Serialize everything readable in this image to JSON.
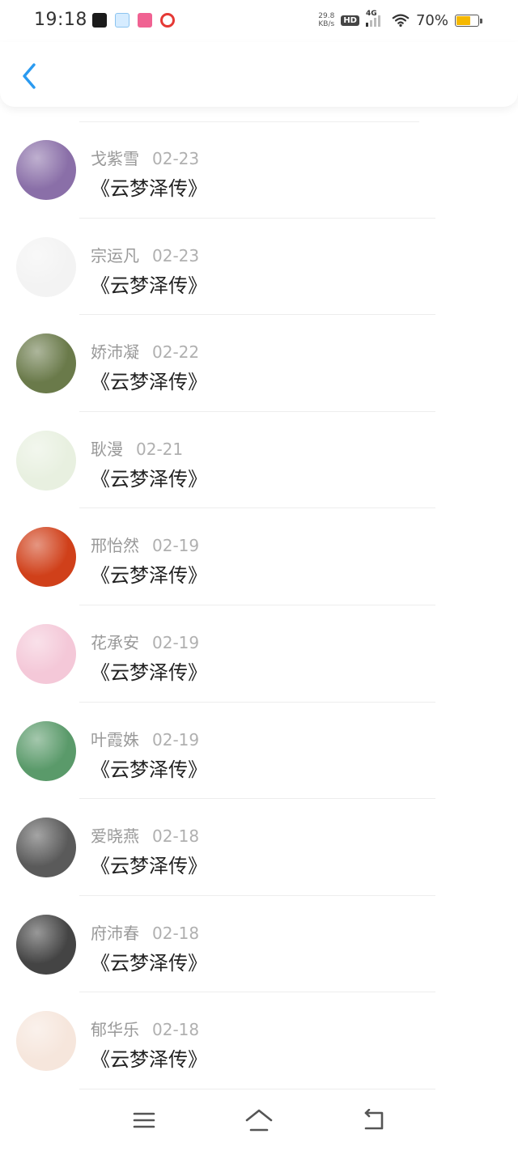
{
  "status_bar": {
    "time": "19:18",
    "net_speed_value": "29.8",
    "net_speed_unit": "KB/s",
    "hd_label": "HD",
    "network_label": "4G",
    "battery_text": "70%",
    "battery_level": 0.7,
    "app_icons": [
      "app-icon-1",
      "app-icon-2",
      "app-icon-3",
      "app-icon-4"
    ]
  },
  "header": {
    "back_icon": "chevron-left-icon",
    "accent_color": "#2a9af0"
  },
  "list": {
    "items": [
      {
        "name": "戈紫雪",
        "date": "02-23",
        "book": "《云梦泽传》",
        "avatar_color": "#8a6fa8"
      },
      {
        "name": "宗运凡",
        "date": "02-23",
        "book": "《云梦泽传》",
        "avatar_color": "#f3f3f3"
      },
      {
        "name": "娇沛凝",
        "date": "02-22",
        "book": "《云梦泽传》",
        "avatar_color": "#6a7a4a"
      },
      {
        "name": "耿漫",
        "date": "02-21",
        "book": "《云梦泽传》",
        "avatar_color": "#e8f0e0"
      },
      {
        "name": "邢怡然",
        "date": "02-19",
        "book": "《云梦泽传》",
        "avatar_color": "#d0401a"
      },
      {
        "name": "花承安",
        "date": "02-19",
        "book": "《云梦泽传》",
        "avatar_color": "#f4c8d8"
      },
      {
        "name": "叶霞姝",
        "date": "02-19",
        "book": "《云梦泽传》",
        "avatar_color": "#5a9a6a"
      },
      {
        "name": "爱晓燕",
        "date": "02-18",
        "book": "《云梦泽传》",
        "avatar_color": "#5a5a5a"
      },
      {
        "name": "府沛春",
        "date": "02-18",
        "book": "《云梦泽传》",
        "avatar_color": "#444444"
      },
      {
        "name": "郁华乐",
        "date": "02-18",
        "book": "《云梦泽传》",
        "avatar_color": "#f6e6dc"
      }
    ]
  },
  "bottom_nav": {
    "menu_icon": "menu-icon",
    "home_icon": "home-icon",
    "back_icon": "back-icon"
  }
}
